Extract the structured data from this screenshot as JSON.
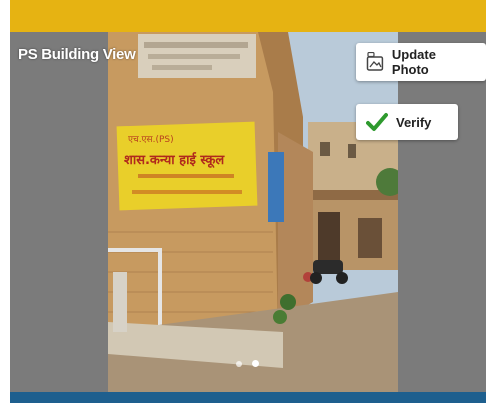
{
  "photo": {
    "caption": "PS Building View",
    "sign_lines": [
      "शास.कन्या हाई स्कूल"
    ],
    "carousel_dot_count": 2,
    "active_dot_index": 1
  },
  "actions": {
    "update_photo_label": "Update Photo",
    "verify_label": "Verify"
  },
  "colors": {
    "top_bar": "#e6b312",
    "bottom_bar": "#1e5f8e",
    "panel_background": "#7b7b7b",
    "verify_check": "#2e9a2e"
  },
  "icons": {
    "update_photo": "image-upload-icon",
    "verify": "checkmark-icon"
  }
}
